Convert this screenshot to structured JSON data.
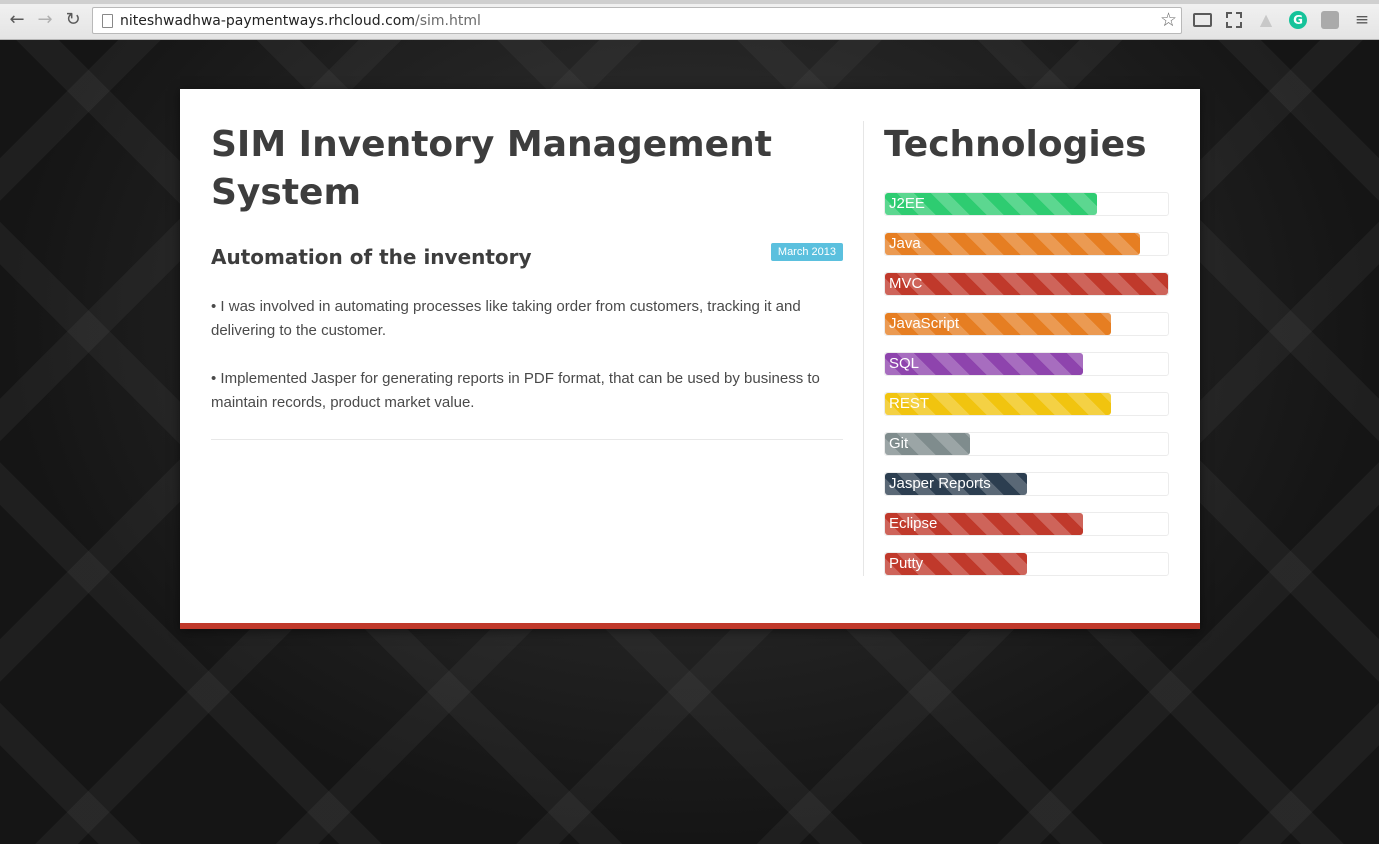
{
  "browser": {
    "url_host": "niteshwadhwa-paymentways.rhcloud.com",
    "url_path": "/sim.html",
    "back_icon": "←",
    "forward_icon": "→",
    "reload_icon": "↻",
    "star_icon": "☆",
    "menu_icon": "≡",
    "grammarly_glyph": "G"
  },
  "project": {
    "title": "SIM Inventory Management System",
    "subtitle": "Automation of the inventory",
    "date": "March 2013",
    "bullets": [
      "• I was involved in automating processes like taking order from customers, tracking it and delivering to the customer.",
      "• Implemented Jasper for generating reports in PDF format, that can be used by business to maintain records, product market value."
    ]
  },
  "technologies": {
    "title": "Technologies",
    "skills": [
      {
        "name": "J2EE",
        "level": 0.75,
        "color": "#2ecc71"
      },
      {
        "name": "Java",
        "level": 0.9,
        "color": "#e67e22"
      },
      {
        "name": "MVC",
        "level": 1.0,
        "color": "#c0392b"
      },
      {
        "name": "JavaScript",
        "level": 0.8,
        "color": "#e67e22"
      },
      {
        "name": "SQL",
        "level": 0.7,
        "color": "#8e44ad"
      },
      {
        "name": "REST",
        "level": 0.8,
        "color": "#f1c40f"
      },
      {
        "name": "Git",
        "level": 0.3,
        "color": "#7f8c8d"
      },
      {
        "name": "Jasper Reports",
        "level": 0.5,
        "color": "#2c3e50"
      },
      {
        "name": "Eclipse",
        "level": 0.7,
        "color": "#c0392b"
      },
      {
        "name": "Putty",
        "level": 0.5,
        "color": "#c0392b"
      }
    ]
  },
  "accent_color": "#c0392b"
}
